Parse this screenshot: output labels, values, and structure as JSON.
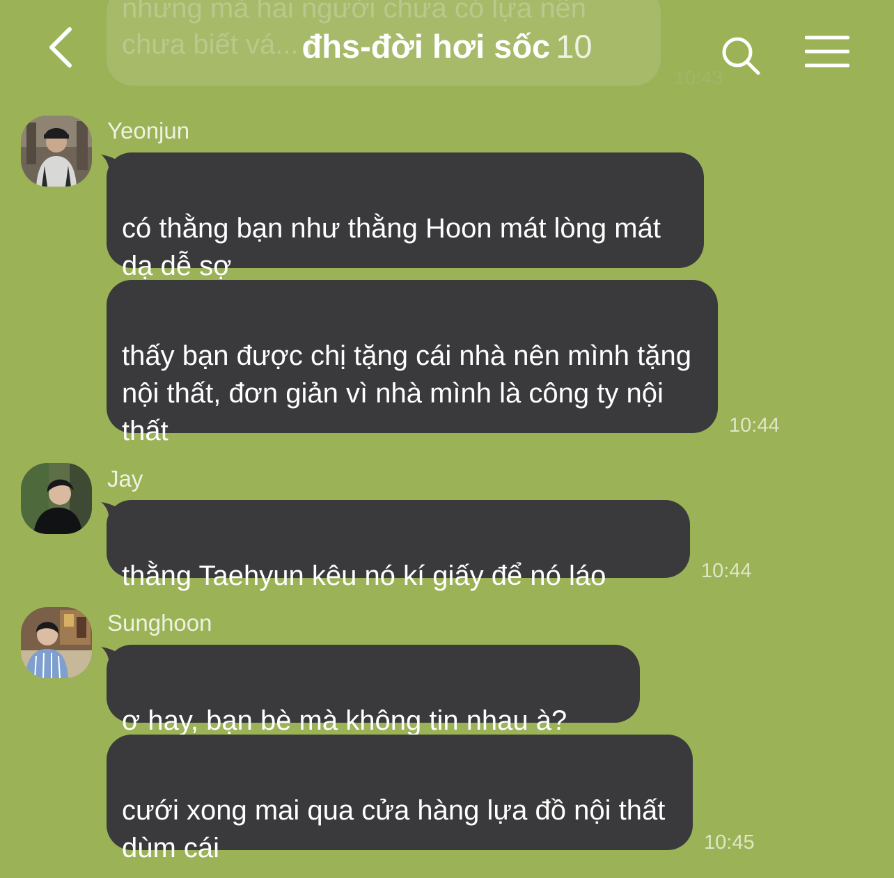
{
  "header": {
    "title": "đhs-đời hơi sốc",
    "member_count": "10",
    "back_icon": "chevron-left-icon",
    "search_icon": "search-icon",
    "menu_icon": "hamburger-menu-icon"
  },
  "previous_message": {
    "text": "nhưng mà hai người chưa có lựa nên chưa biết vá... ri",
    "time": "10:43"
  },
  "messages": [
    {
      "sender": "Yeonjun",
      "bubbles": [
        "có thằng bạn như thằng Hoon mát lòng mát dạ dễ sợ",
        "thấy bạn được chị tặng cái nhà nên mình tặng nội thất, đơn giản vì nhà mình là công ty nội thất"
      ],
      "time": "10:44"
    },
    {
      "sender": "Jay",
      "bubbles": [
        "thằng Taehyun kêu nó kí giấy để nó láo"
      ],
      "time": "10:44"
    },
    {
      "sender": "Sunghoon",
      "bubbles": [
        "ơ hay, bạn bè mà không tin nhau à?",
        "cưới xong mai qua cửa hàng lựa đồ nội thất dùm cái"
      ],
      "time": "10:45"
    }
  ],
  "colors": {
    "background": "#9bb257",
    "bubble": "#3a3a3c",
    "bubble_text": "#ffffff"
  }
}
